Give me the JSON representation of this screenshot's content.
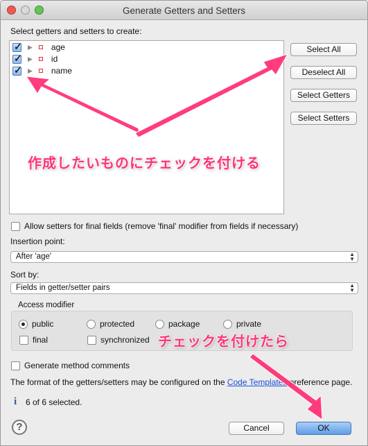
{
  "window": {
    "title": "Generate Getters and Setters"
  },
  "list": {
    "label": "Select getters and setters to create:",
    "items": [
      {
        "name": "age",
        "checked": true
      },
      {
        "name": "id",
        "checked": true
      },
      {
        "name": "name",
        "checked": true
      }
    ]
  },
  "buttons": {
    "select_all": "Select All",
    "deselect_all": "Deselect All",
    "select_getters": "Select Getters",
    "select_setters": "Select Setters",
    "cancel": "Cancel",
    "ok": "OK"
  },
  "allow_setters_final": {
    "label": "Allow setters for final fields (remove 'final' modifier from fields if necessary)",
    "checked": false
  },
  "insertion_point": {
    "label": "Insertion point:",
    "value": "After 'age'"
  },
  "sort_by": {
    "label": "Sort by:",
    "value": "Fields in getter/setter pairs"
  },
  "access_modifier": {
    "label": "Access modifier",
    "options": [
      "public",
      "protected",
      "package",
      "private"
    ],
    "selected": "public",
    "final_label": "final",
    "synchronized_label": "synchronized"
  },
  "generate_comments": {
    "label": "Generate method comments",
    "checked": false
  },
  "format_note": {
    "before": "The format of the getters/setters may be configured on the ",
    "link": "Code Templates",
    "after": " preference page."
  },
  "status": "6 of 6 selected.",
  "annotations": {
    "top": "作成したいものにチェックを付ける",
    "bottom": "チェックを付けたら",
    "color": "#ff3377"
  }
}
